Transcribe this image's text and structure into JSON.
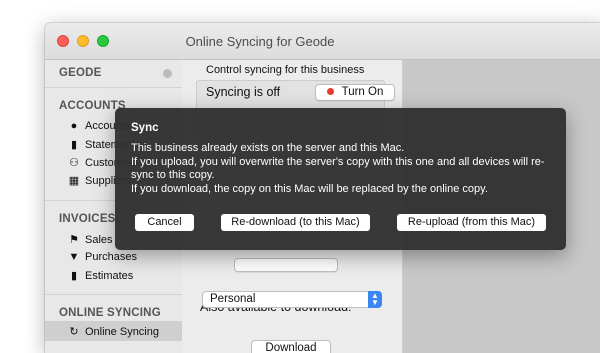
{
  "window": {
    "title": "Online Syncing for Geode"
  },
  "sidebar": {
    "business_name": "GEODE",
    "sections": [
      {
        "title": "ACCOUNTS",
        "items": [
          {
            "label": "Accounts",
            "icon": "piggy-bank-icon"
          },
          {
            "label": "Statements",
            "icon": "statement-icon"
          },
          {
            "label": "Customers",
            "icon": "customers-icon"
          },
          {
            "label": "Suppliers",
            "icon": "suppliers-icon"
          }
        ]
      },
      {
        "title": "INVOICES",
        "items": [
          {
            "label": "Sales",
            "icon": "tag-icon"
          },
          {
            "label": "Purchases",
            "icon": "basket-icon"
          },
          {
            "label": "Estimates",
            "icon": "clipboard-icon"
          }
        ]
      },
      {
        "title": "ONLINE SYNCING",
        "items": [
          {
            "label": "Online Syncing",
            "icon": "sync-icon",
            "selected": true
          }
        ]
      }
    ]
  },
  "panel": {
    "control_label": "Control syncing for this business",
    "status": "Syncing is off",
    "turn_on_label": "Turn On",
    "turn_on_dot_color": "#e53b2f",
    "also_available_label": "Also available to download:",
    "download_option": "Personal",
    "download_label": "Download"
  },
  "dialog": {
    "title": "Sync",
    "lines": [
      "This business already exists on the server and this Mac.",
      "If you upload, you will overwrite the server's copy with this one and all devices will re-sync to this copy.",
      "If you download, the copy on this Mac will be replaced by the online copy."
    ],
    "cancel_label": "Cancel",
    "redownload_label": "Re-download (to this Mac)",
    "reupload_label": "Re-upload (from this Mac)"
  }
}
